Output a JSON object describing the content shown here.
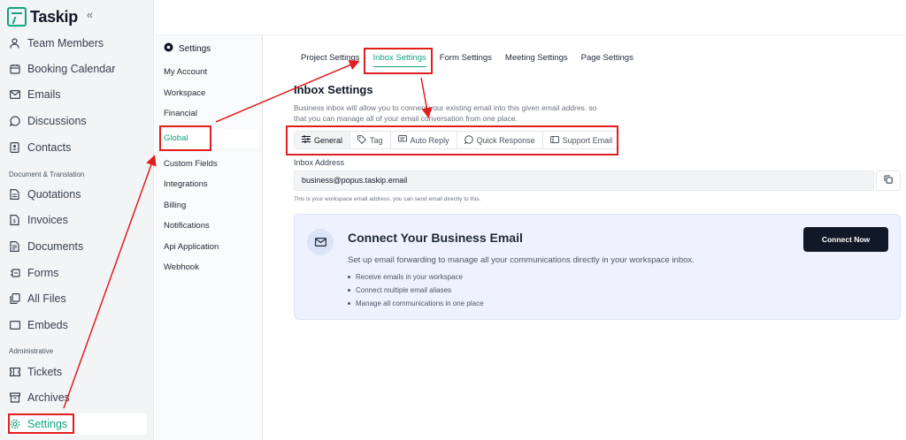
{
  "app": {
    "name": "Taskip",
    "collapse_glyph": "«"
  },
  "sidebar": {
    "items": [
      {
        "label": "Team Members",
        "icon": "user-icon"
      },
      {
        "label": "Booking Calendar",
        "icon": "calendar-icon"
      },
      {
        "label": "Emails",
        "icon": "mail-icon"
      },
      {
        "label": "Discussions",
        "icon": "chat-icon"
      },
      {
        "label": "Contacts",
        "icon": "contact-icon"
      }
    ],
    "section_document": "Document & Translation",
    "doc_items": [
      {
        "label": "Quotations",
        "icon": "quotation-icon"
      },
      {
        "label": "Invoices",
        "icon": "invoice-icon"
      },
      {
        "label": "Documents",
        "icon": "document-icon"
      },
      {
        "label": "Forms",
        "icon": "form-icon"
      },
      {
        "label": "All Files",
        "icon": "files-icon"
      },
      {
        "label": "Embeds",
        "icon": "embed-icon"
      }
    ],
    "section_admin": "Administrative",
    "admin_items": [
      {
        "label": "Tickets",
        "icon": "ticket-icon"
      },
      {
        "label": "Archives",
        "icon": "archive-icon"
      },
      {
        "label": "Settings",
        "icon": "gear-icon",
        "active": true
      }
    ]
  },
  "subnav": {
    "title": "Settings",
    "items": [
      "My Account",
      "Workspace",
      "Financial",
      "Global",
      "Custom Fields",
      "Integrations",
      "Billing",
      "Notifications",
      "Api Application",
      "Webhook"
    ],
    "active": "Global"
  },
  "tabs": {
    "items": [
      "Project Settings",
      "Inbox Settings",
      "Form Settings",
      "Meeting Settings",
      "Page Settings"
    ],
    "active": "Inbox Settings"
  },
  "inbox": {
    "title": "Inbox Settings",
    "description": "Business inbox will allow you to connect your existing email into this given email addres. so that you can manage all of your email conversation from one place.",
    "subtabs": [
      {
        "label": "General",
        "icon": "sliders-icon",
        "active": true
      },
      {
        "label": "Tag",
        "icon": "tag-icon"
      },
      {
        "label": "Auto Reply",
        "icon": "reply-icon"
      },
      {
        "label": "Quick Response",
        "icon": "chat-icon"
      },
      {
        "label": "Support Email",
        "icon": "support-icon"
      }
    ],
    "address_label": "Inbox Address",
    "address_value": "business@popus.taskip.email",
    "address_help": "This is your workspace email address, you can send email directly to this."
  },
  "connect_card": {
    "title": "Connect Your Business Email",
    "description": "Set up email forwarding to manage all your communications directly in your workspace inbox.",
    "bullets": [
      "Receive emails in your workspace",
      "Connect multiple email aliases",
      "Manage all communications in one place"
    ],
    "button": "Connect Now"
  },
  "colors": {
    "accent": "#10a37f",
    "annotation": "#e11d1d",
    "button_dark": "#111827"
  }
}
